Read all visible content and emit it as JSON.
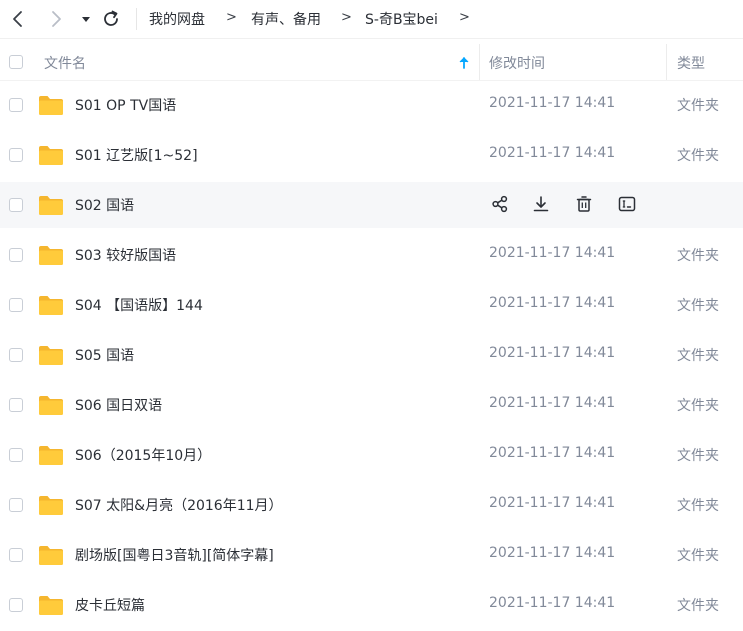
{
  "toolbar": {
    "icons": [
      "chevron-left-icon",
      "chevron-right-icon",
      "caret-down-icon",
      "refresh-icon"
    ],
    "breadcrumbs": [
      "我的网盘",
      "有声、备用",
      "S-奇B宝bei"
    ],
    "separator": ">"
  },
  "table": {
    "headers": {
      "name": "文件名",
      "modified": "修改时间",
      "type": "类型"
    },
    "sort": {
      "column": "name",
      "direction": "asc",
      "icon": "arrow-up-icon",
      "color": "#06a7ff"
    },
    "rows": [
      {
        "name": "S01 OP TV国语",
        "modified": "2021-11-17 14:41",
        "type": "文件夹"
      },
      {
        "name": "S01 辽艺版[1~52]",
        "modified": "2021-11-17 14:41",
        "type": "文件夹"
      },
      {
        "name": "S02 国语",
        "modified": "",
        "type": "",
        "hovered": true
      },
      {
        "name": "S03 较好版国语",
        "modified": "2021-11-17 14:41",
        "type": "文件夹"
      },
      {
        "name": "S04 【国语版】144",
        "modified": "2021-11-17 14:41",
        "type": "文件夹"
      },
      {
        "name": "S05 国语",
        "modified": "2021-11-17 14:41",
        "type": "文件夹"
      },
      {
        "name": "S06 国日双语",
        "modified": "2021-11-17 14:41",
        "type": "文件夹"
      },
      {
        "name": "S06（2015年10月）",
        "modified": "2021-11-17 14:41",
        "type": "文件夹"
      },
      {
        "name": "S07 太阳&月亮（2016年11月）",
        "modified": "2021-11-17 14:41",
        "type": "文件夹"
      },
      {
        "name": "剧场版[国粤日3音轨][简体字幕]",
        "modified": "2021-11-17 14:41",
        "type": "文件夹"
      },
      {
        "name": "皮卡丘短篇",
        "modified": "2021-11-17 14:41",
        "type": "文件夹"
      }
    ],
    "hover_actions": [
      "share-icon",
      "download-icon",
      "delete-icon",
      "rename-icon"
    ]
  },
  "colors": {
    "folder": "#ffcb3b",
    "folder_tab": "#f5b62e",
    "hover_row": "#f6f7f9",
    "accent": "#06a7ff"
  }
}
